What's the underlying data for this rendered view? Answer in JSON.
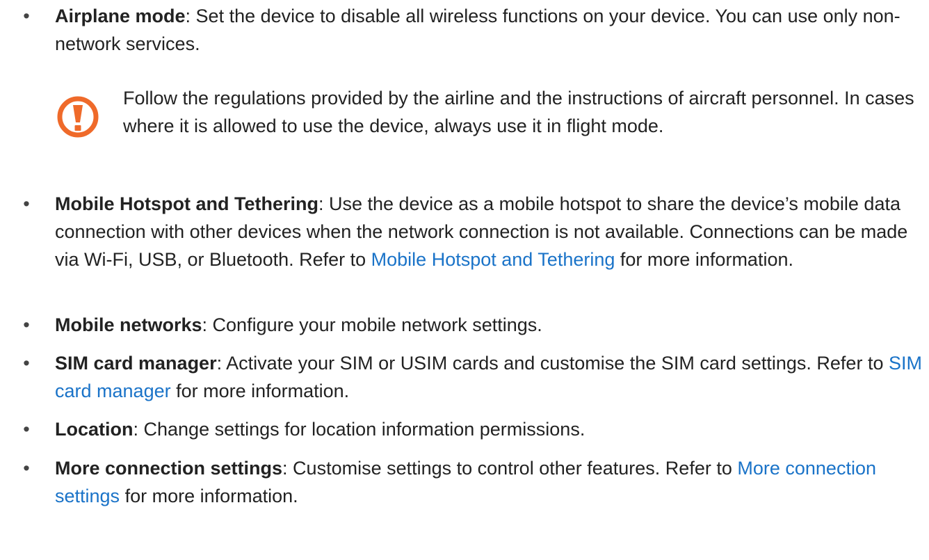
{
  "items": [
    {
      "term": "Airplane mode",
      "text": ": Set the device to disable all wireless functions on your device. You can use only non-network services."
    },
    {
      "term": "Mobile Hotspot and Tethering",
      "text": ": Use the device as a mobile hotspot to share the device’s mobile data connection with other devices when the network connection is not available. Connections can be made via Wi-Fi, USB, or Bluetooth. Refer to ",
      "link": "Mobile Hotspot and Tethering",
      "after": " for more information."
    },
    {
      "term": "Mobile networks",
      "text": ": Configure your mobile network settings."
    },
    {
      "term": "SIM card manager",
      "text": ": Activate your SIM or USIM cards and customise the SIM card settings. Refer to ",
      "link": "SIM card manager",
      "after": " for more information."
    },
    {
      "term": "Location",
      "text": ": Change settings for location information permissions."
    },
    {
      "term": "More connection settings",
      "text": ": Customise settings to control other features. Refer to ",
      "link": "More connection settings",
      "after": " for more information."
    }
  ],
  "bullet_symbol": "•",
  "caution": {
    "icon": "caution-icon",
    "text": "Follow the regulations provided by the airline and the instructions of aircraft personnel. In cases where it is allowed to use the device, always use it in flight mode."
  },
  "colors": {
    "link": "#1a73c8",
    "caution": "#ef6a2a",
    "text": "#222222"
  }
}
